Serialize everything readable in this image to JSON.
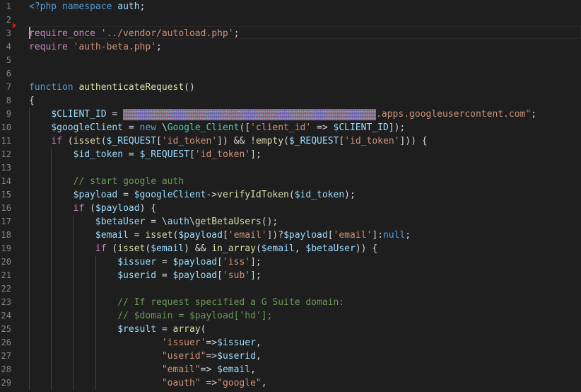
{
  "editor": {
    "language": "php",
    "theme_colors": {
      "background": "#1e1e1e",
      "keyword": "#569cd6",
      "control": "#c586c0",
      "string": "#ce9178",
      "variable": "#9cdcfe",
      "function": "#dcdcaa",
      "type": "#4ec9b0",
      "comment": "#6a9955",
      "line_number": "#858585"
    },
    "client_id_redacted": true,
    "lines": [
      {
        "n": "1",
        "tokens": [
          {
            "c": "k",
            "t": "<?php "
          },
          {
            "c": "k",
            "t": "namespace"
          },
          {
            "c": "p",
            "t": " "
          },
          {
            "c": "v",
            "t": "auth"
          },
          {
            "c": "p",
            "t": ";"
          }
        ]
      },
      {
        "n": "2",
        "tokens": []
      },
      {
        "n": "3",
        "tokens": [
          {
            "c": "c",
            "t": "require_once"
          },
          {
            "c": "p",
            "t": " "
          },
          {
            "c": "s",
            "t": "'../vendor/autoload.php'"
          },
          {
            "c": "p",
            "t": ";"
          }
        ]
      },
      {
        "n": "4",
        "tokens": [
          {
            "c": "c",
            "t": "require"
          },
          {
            "c": "p",
            "t": " "
          },
          {
            "c": "s",
            "t": "'auth-beta.php'"
          },
          {
            "c": "p",
            "t": ";"
          }
        ]
      },
      {
        "n": "5",
        "tokens": []
      },
      {
        "n": "6",
        "tokens": []
      },
      {
        "n": "7",
        "tokens": [
          {
            "c": "k",
            "t": "function"
          },
          {
            "c": "p",
            "t": " "
          },
          {
            "c": "f",
            "t": "authenticateRequest"
          },
          {
            "c": "p",
            "t": "()"
          }
        ]
      },
      {
        "n": "8",
        "tokens": [
          {
            "c": "p",
            "t": "{"
          }
        ]
      },
      {
        "n": "9",
        "tokens": [
          {
            "c": "p",
            "t": "    "
          },
          {
            "c": "v",
            "t": "$CLIENT_ID"
          },
          {
            "c": "p",
            "t": " = "
          },
          {
            "c": "redact",
            "t": ""
          },
          {
            "c": "s",
            "t": ".apps.googleusercontent.com\""
          },
          {
            "c": "p",
            "t": ";"
          }
        ]
      },
      {
        "n": "10",
        "tokens": [
          {
            "c": "p",
            "t": "    "
          },
          {
            "c": "v",
            "t": "$googleClient"
          },
          {
            "c": "p",
            "t": " = "
          },
          {
            "c": "k",
            "t": "new"
          },
          {
            "c": "p",
            "t": " \\"
          },
          {
            "c": "t",
            "t": "Google_Client"
          },
          {
            "c": "p",
            "t": "(["
          },
          {
            "c": "s",
            "t": "'client_id'"
          },
          {
            "c": "p",
            "t": " => "
          },
          {
            "c": "v",
            "t": "$CLIENT_ID"
          },
          {
            "c": "p",
            "t": "]);"
          }
        ]
      },
      {
        "n": "11",
        "tokens": [
          {
            "c": "p",
            "t": "    "
          },
          {
            "c": "c",
            "t": "if"
          },
          {
            "c": "p",
            "t": " ("
          },
          {
            "c": "f",
            "t": "isset"
          },
          {
            "c": "p",
            "t": "("
          },
          {
            "c": "v",
            "t": "$_REQUEST"
          },
          {
            "c": "p",
            "t": "["
          },
          {
            "c": "s",
            "t": "'id_token'"
          },
          {
            "c": "p",
            "t": "]) && !"
          },
          {
            "c": "f",
            "t": "empty"
          },
          {
            "c": "p",
            "t": "("
          },
          {
            "c": "v",
            "t": "$_REQUEST"
          },
          {
            "c": "p",
            "t": "["
          },
          {
            "c": "s",
            "t": "'id_token'"
          },
          {
            "c": "p",
            "t": "])) {"
          }
        ]
      },
      {
        "n": "12",
        "tokens": [
          {
            "c": "p",
            "t": "        "
          },
          {
            "c": "v",
            "t": "$id_token"
          },
          {
            "c": "p",
            "t": " = "
          },
          {
            "c": "v",
            "t": "$_REQUEST"
          },
          {
            "c": "p",
            "t": "["
          },
          {
            "c": "s",
            "t": "'id_token'"
          },
          {
            "c": "p",
            "t": "];"
          }
        ]
      },
      {
        "n": "13",
        "tokens": []
      },
      {
        "n": "14",
        "tokens": [
          {
            "c": "p",
            "t": "        "
          },
          {
            "c": "m",
            "t": "// start google auth"
          }
        ]
      },
      {
        "n": "15",
        "tokens": [
          {
            "c": "p",
            "t": "        "
          },
          {
            "c": "v",
            "t": "$payload"
          },
          {
            "c": "p",
            "t": " = "
          },
          {
            "c": "v",
            "t": "$googleClient"
          },
          {
            "c": "p",
            "t": "->"
          },
          {
            "c": "f",
            "t": "verifyIdToken"
          },
          {
            "c": "p",
            "t": "("
          },
          {
            "c": "v",
            "t": "$id_token"
          },
          {
            "c": "p",
            "t": ");"
          }
        ]
      },
      {
        "n": "16",
        "tokens": [
          {
            "c": "p",
            "t": "        "
          },
          {
            "c": "c",
            "t": "if"
          },
          {
            "c": "p",
            "t": " ("
          },
          {
            "c": "v",
            "t": "$payload"
          },
          {
            "c": "p",
            "t": ") {"
          }
        ]
      },
      {
        "n": "17",
        "tokens": [
          {
            "c": "p",
            "t": "            "
          },
          {
            "c": "v",
            "t": "$betaUser"
          },
          {
            "c": "p",
            "t": " = \\"
          },
          {
            "c": "v",
            "t": "auth"
          },
          {
            "c": "p",
            "t": "\\"
          },
          {
            "c": "f",
            "t": "getBetaUsers"
          },
          {
            "c": "p",
            "t": "();"
          }
        ]
      },
      {
        "n": "18",
        "tokens": [
          {
            "c": "p",
            "t": "            "
          },
          {
            "c": "v",
            "t": "$email"
          },
          {
            "c": "p",
            "t": " = "
          },
          {
            "c": "f",
            "t": "isset"
          },
          {
            "c": "p",
            "t": "("
          },
          {
            "c": "v",
            "t": "$payload"
          },
          {
            "c": "p",
            "t": "["
          },
          {
            "c": "s",
            "t": "'email'"
          },
          {
            "c": "p",
            "t": "])?"
          },
          {
            "c": "v",
            "t": "$payload"
          },
          {
            "c": "p",
            "t": "["
          },
          {
            "c": "s",
            "t": "'email'"
          },
          {
            "c": "p",
            "t": "]:"
          },
          {
            "c": "k",
            "t": "null"
          },
          {
            "c": "p",
            "t": ";"
          }
        ]
      },
      {
        "n": "19",
        "tokens": [
          {
            "c": "p",
            "t": "            "
          },
          {
            "c": "c",
            "t": "if"
          },
          {
            "c": "p",
            "t": " ("
          },
          {
            "c": "f",
            "t": "isset"
          },
          {
            "c": "p",
            "t": "("
          },
          {
            "c": "v",
            "t": "$email"
          },
          {
            "c": "p",
            "t": ") && "
          },
          {
            "c": "f",
            "t": "in_array"
          },
          {
            "c": "p",
            "t": "("
          },
          {
            "c": "v",
            "t": "$email"
          },
          {
            "c": "p",
            "t": ", "
          },
          {
            "c": "v",
            "t": "$betaUser"
          },
          {
            "c": "p",
            "t": ")) {"
          }
        ]
      },
      {
        "n": "20",
        "tokens": [
          {
            "c": "p",
            "t": "                "
          },
          {
            "c": "v",
            "t": "$issuer"
          },
          {
            "c": "p",
            "t": " = "
          },
          {
            "c": "v",
            "t": "$payload"
          },
          {
            "c": "p",
            "t": "["
          },
          {
            "c": "s",
            "t": "'iss'"
          },
          {
            "c": "p",
            "t": "];"
          }
        ]
      },
      {
        "n": "21",
        "tokens": [
          {
            "c": "p",
            "t": "                "
          },
          {
            "c": "v",
            "t": "$userid"
          },
          {
            "c": "p",
            "t": " = "
          },
          {
            "c": "v",
            "t": "$payload"
          },
          {
            "c": "p",
            "t": "["
          },
          {
            "c": "s",
            "t": "'sub'"
          },
          {
            "c": "p",
            "t": "];"
          }
        ]
      },
      {
        "n": "22",
        "tokens": []
      },
      {
        "n": "23",
        "tokens": [
          {
            "c": "p",
            "t": "                "
          },
          {
            "c": "m",
            "t": "// If request specified a G Suite domain:"
          }
        ]
      },
      {
        "n": "24",
        "tokens": [
          {
            "c": "p",
            "t": "                "
          },
          {
            "c": "m",
            "t": "// $domain = $payload['hd'];"
          }
        ]
      },
      {
        "n": "25",
        "tokens": [
          {
            "c": "p",
            "t": "                "
          },
          {
            "c": "v",
            "t": "$result"
          },
          {
            "c": "p",
            "t": " = "
          },
          {
            "c": "f",
            "t": "array"
          },
          {
            "c": "p",
            "t": "("
          }
        ]
      },
      {
        "n": "26",
        "tokens": [
          {
            "c": "p",
            "t": "                        "
          },
          {
            "c": "s",
            "t": "'issuer'"
          },
          {
            "c": "p",
            "t": "=>"
          },
          {
            "c": "v",
            "t": "$issuer"
          },
          {
            "c": "p",
            "t": ","
          }
        ]
      },
      {
        "n": "27",
        "tokens": [
          {
            "c": "p",
            "t": "                        "
          },
          {
            "c": "s",
            "t": "\"userid\""
          },
          {
            "c": "p",
            "t": "=>"
          },
          {
            "c": "v",
            "t": "$userid"
          },
          {
            "c": "p",
            "t": ","
          }
        ]
      },
      {
        "n": "28",
        "tokens": [
          {
            "c": "p",
            "t": "                        "
          },
          {
            "c": "s",
            "t": "\"email\""
          },
          {
            "c": "p",
            "t": "=> "
          },
          {
            "c": "v",
            "t": "$email"
          },
          {
            "c": "p",
            "t": ","
          }
        ]
      },
      {
        "n": "29",
        "tokens": [
          {
            "c": "p",
            "t": "                        "
          },
          {
            "c": "s",
            "t": "\"oauth\""
          },
          {
            "c": "p",
            "t": " =>"
          },
          {
            "c": "s",
            "t": "\"google\""
          },
          {
            "c": "p",
            "t": ","
          }
        ]
      }
    ]
  }
}
